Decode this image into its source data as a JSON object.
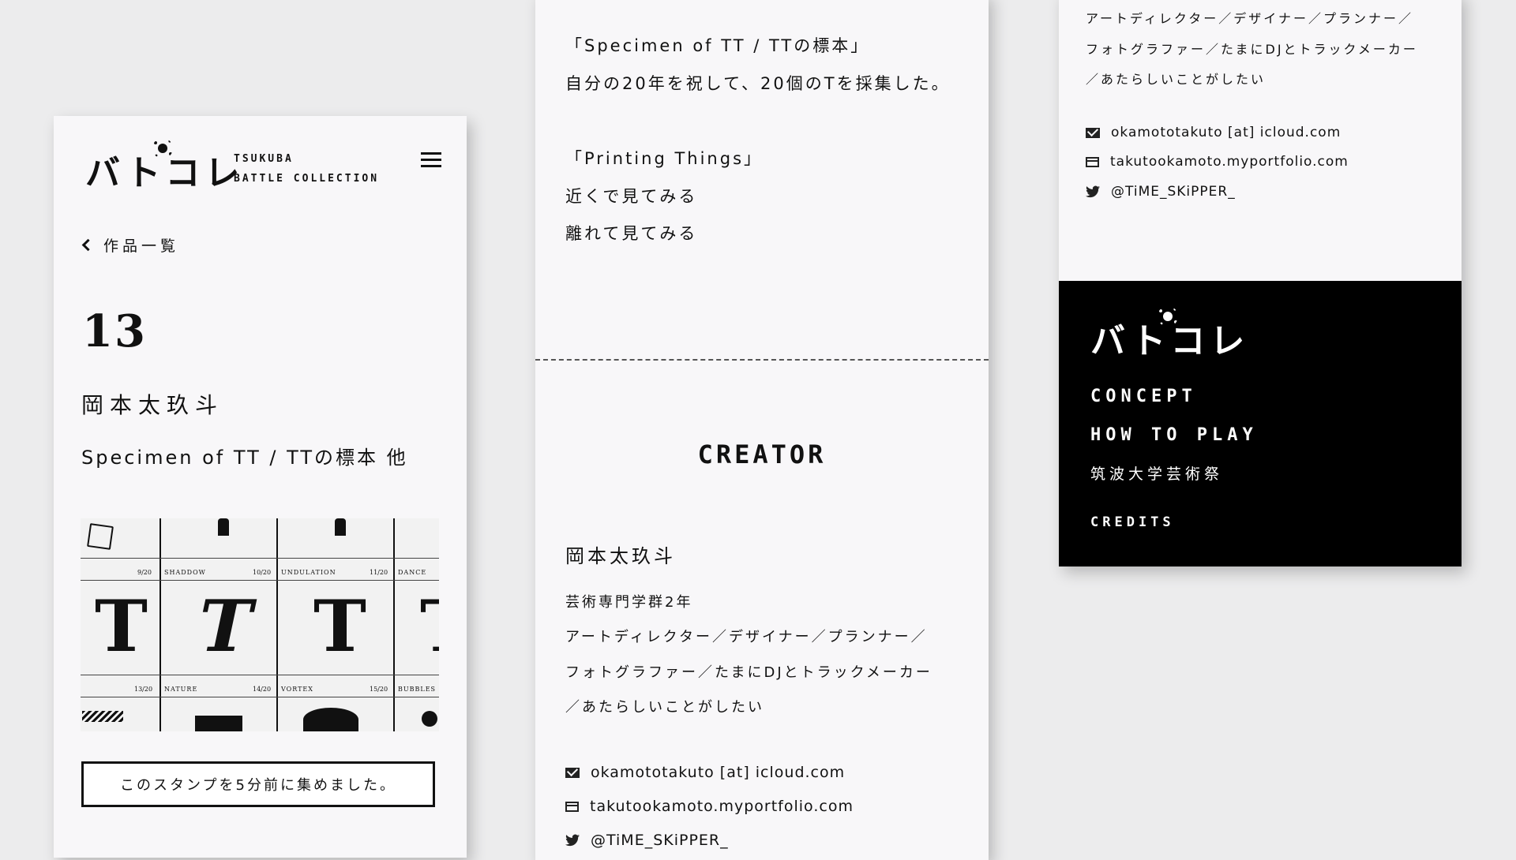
{
  "logo": {
    "glyphs": "バトコレ"
  },
  "header": {
    "tagline_line1": "TSUKUBA",
    "tagline_line2": "BATTLE COLLECTION"
  },
  "nav": {
    "back_label": "作品一覧"
  },
  "work": {
    "number": "13",
    "creator": "岡本太玖斗",
    "title": "Specimen of TT / TTの標本 他"
  },
  "stamp": {
    "cells": [
      {
        "name": "",
        "fraction": "9/20"
      },
      {
        "name": "SHADDOW",
        "fraction": "10/20"
      },
      {
        "name": "UNDULATION",
        "fraction": "11/20"
      },
      {
        "name": "DANCE",
        "fraction": ""
      },
      {
        "name": "",
        "fraction": "13/20"
      },
      {
        "name": "NATURE",
        "fraction": "14/20"
      },
      {
        "name": "VORTEX",
        "fraction": "15/20"
      },
      {
        "name": "BUBBLES",
        "fraction": ""
      }
    ],
    "glyph": "T"
  },
  "cta": {
    "label": "このスタンプを5分前に集めました。"
  },
  "description": {
    "line1": "「Specimen of TT / TTの標本」",
    "line2": "自分の20年を祝して、20個のTを採集した。",
    "line3": "「Printing Things」",
    "line4": "近くで見てみる",
    "line5": "離れて見てみる"
  },
  "creator_section": {
    "heading": "CREATOR",
    "name": "岡本太玖斗",
    "affiliation": "芸術専門学群2年",
    "bio_line1": "アートディレクター／デザイナー／プランナー／",
    "bio_line2": "フォトグラファー／たまにDJとトラックメーカー",
    "bio_line3": "／あたらしいことがしたい",
    "email": "okamototakuto [at] icloud.com",
    "website": "takutookamoto.myportfolio.com",
    "twitter": "@TiME_SKiPPER_"
  },
  "footer": {
    "concept": "CONCEPT",
    "how_to_play": "HOW TO PLAY",
    "festival": "筑波大学芸術祭",
    "credits": "CREDITS"
  },
  "icons": [
    "menu-icon",
    "chevron-left-icon",
    "mail-icon",
    "web-icon",
    "twitter-icon"
  ]
}
